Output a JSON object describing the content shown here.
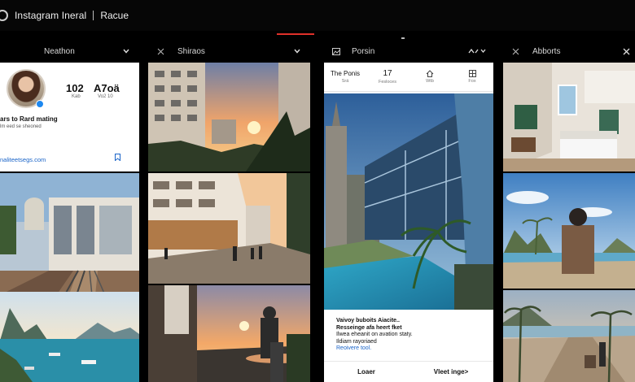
{
  "window": {
    "app_title": "Instagram Ineral",
    "section": "Racue"
  },
  "columns": [
    {
      "header": "Neathon"
    },
    {
      "header": "Shiraos"
    },
    {
      "header": "Porsin"
    },
    {
      "header": "Abborts"
    }
  ],
  "profile": {
    "posts_count": "102",
    "posts_label": "Kab",
    "followers_count": "A7oä",
    "followers_label": "Vo2 10",
    "bio_name": "ars to Rard mating",
    "bio_line": "lm eed se sheoned",
    "link": "naliteetsegs.com"
  },
  "post": {
    "tabs": [
      {
        "title": "The Ponis",
        "sub": "Srä"
      },
      {
        "title": "17",
        "sub": "Fesloces"
      },
      {
        "title": "",
        "sub": "Wtb"
      },
      {
        "title": "",
        "sub": "Fox"
      }
    ],
    "caption_lines": [
      "Vaivoy buboits Aiacite..",
      "Resseinge afa heert fket",
      "Ilwea eheanit on avation staty.",
      "Ildiam rayoriaed",
      "Reoivere tool."
    ],
    "action_left": "Loaer",
    "action_right": "Vleet inge>"
  },
  "colors": {
    "accent_red": "#e0312a",
    "link_blue": "#1a64c8",
    "verified_blue": "#1d88f0"
  }
}
